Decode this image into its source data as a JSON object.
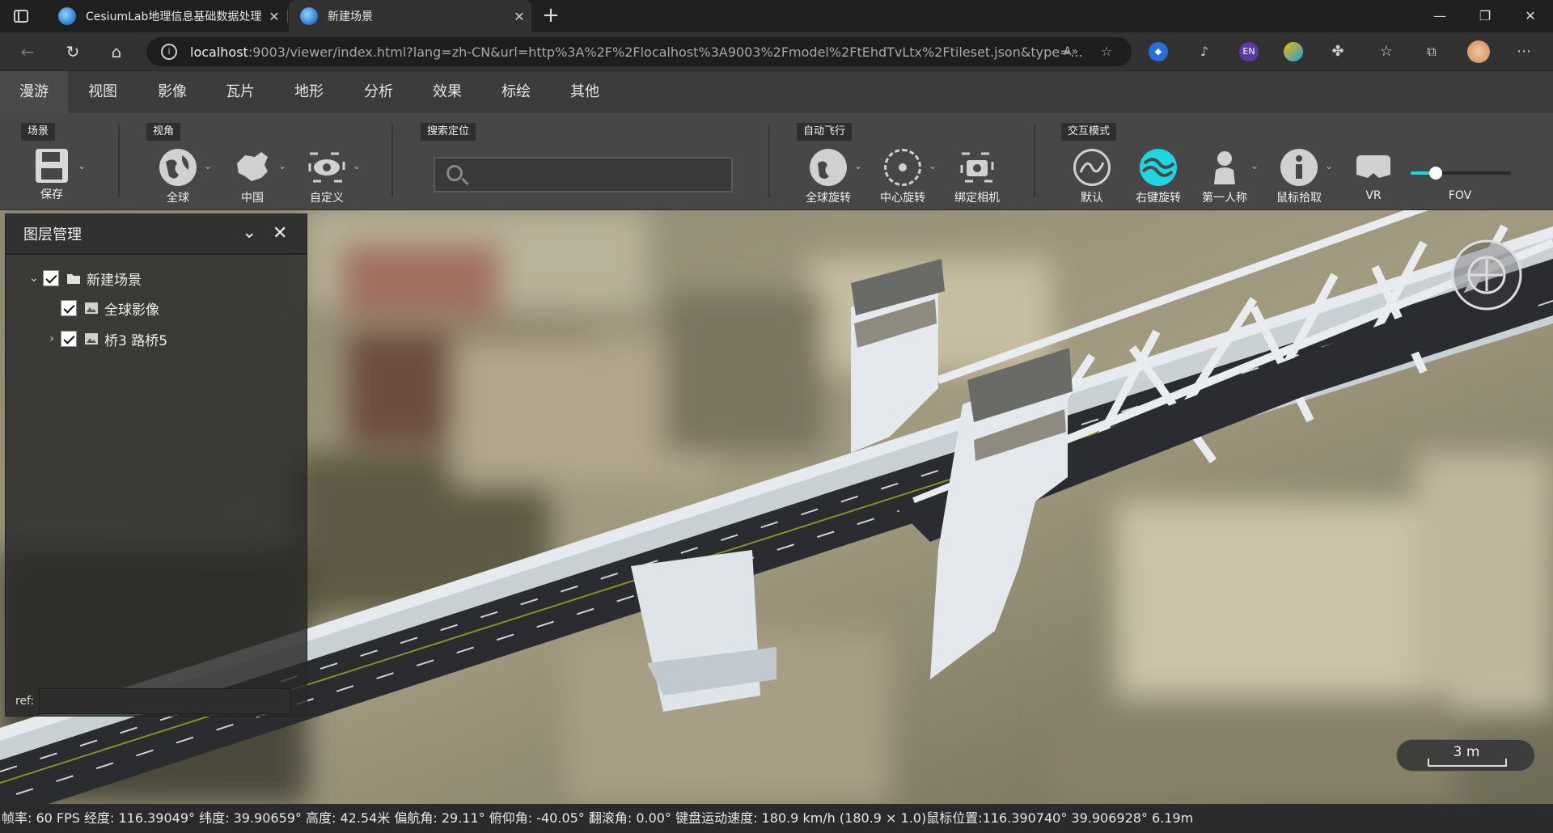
{
  "browser": {
    "tabs": [
      {
        "title": "CesiumLab地理信息基础数据处理",
        "active": false
      },
      {
        "title": "新建场景",
        "active": true
      }
    ],
    "url_host": "localhost",
    "url_rest": ":9003/viewer/index.html?lang=zh-CN&url=http%3A%2F%2Flocalhost%3A9003%2Fmodel%2FtEhdTvLtx%2Ftileset.json&type=...",
    "extension_en_label": "EN"
  },
  "menu": {
    "items": [
      "漫游",
      "视图",
      "影像",
      "瓦片",
      "地形",
      "分析",
      "效果",
      "标绘",
      "其他"
    ],
    "active_index": 0
  },
  "toolbar": {
    "groups": {
      "scene": "场景",
      "view": "视角",
      "search": "搜索定位",
      "autofly": "自动飞行",
      "interaction": "交互模式"
    },
    "tools": {
      "save": "保存",
      "globe": "全球",
      "china": "中国",
      "custom": "自定义",
      "globe_rotate": "全球旋转",
      "center_rotate": "中心旋转",
      "bind_camera": "绑定相机",
      "default": "默认",
      "right_rotate": "右键旋转",
      "first_person": "第一人称",
      "mouse_pick": "鼠标拾取",
      "vr": "VR",
      "fov": "FOV"
    },
    "fov_level": 0.25,
    "accent": "#21d5e0"
  },
  "layer_panel": {
    "title": "图层管理",
    "nodes": [
      {
        "label": "新建场景",
        "checked": true,
        "expanded": true
      },
      {
        "label": "全球影像",
        "checked": true
      },
      {
        "label": "桥3 路桥5",
        "checked": true,
        "expanded": false
      }
    ],
    "ref_label": "ref:",
    "ref_value": ""
  },
  "scale": {
    "label": "3 m"
  },
  "status": {
    "text": "帧率: 60 FPS 经度: 116.39049° 纬度: 39.90659° 高度: 42.54米 偏航角: 29.11° 俯仰角: -40.05° 翻滚角: 0.00° 键盘运动速度: 180.9 km/h (180.9 × 1.0)鼠标位置:116.390740° 39.906928° 6.19m"
  }
}
